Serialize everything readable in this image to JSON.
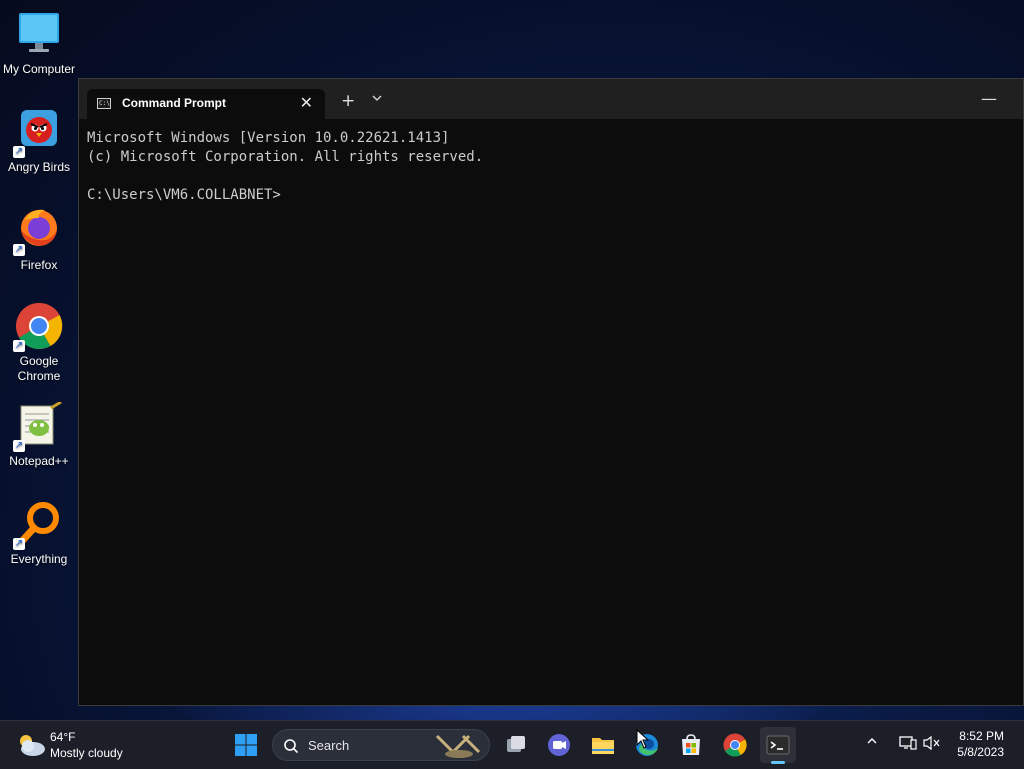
{
  "desktop": {
    "icons": [
      {
        "label": "My Computer",
        "icon": "monitor-icon"
      },
      {
        "label": "Angry Birds",
        "icon": "angry-birds-icon"
      },
      {
        "label": "Firefox",
        "icon": "firefox-icon"
      },
      {
        "label": "Google Chrome",
        "icon": "chrome-icon"
      },
      {
        "label": "Notepad++",
        "icon": "notepadpp-icon"
      },
      {
        "label": "Everything",
        "icon": "everything-search-icon"
      }
    ]
  },
  "terminal": {
    "tab_title": "Command Prompt",
    "tab_close": "✕",
    "new_tab": "+",
    "dropdown": "⌄",
    "minimize": "—",
    "lines": [
      "Microsoft Windows [Version 10.0.22621.1413]",
      "(c) Microsoft Corporation. All rights reserved.",
      "",
      "C:\\Users\\VM6.COLLABNET>"
    ]
  },
  "taskbar": {
    "weather": {
      "temp": "64°F",
      "condition": "Mostly cloudy"
    },
    "search_label": "Search",
    "apps": [
      "start",
      "search",
      "task-view",
      "teams-chat",
      "file-explorer",
      "edge",
      "microsoft-store",
      "chrome",
      "terminal"
    ],
    "tray": {
      "chevron": "^",
      "network": "network-icon",
      "volume": "volume-muted-icon"
    },
    "clock": {
      "time": "8:52 PM",
      "date": "5/8/2023"
    }
  },
  "colors": {
    "terminal_bg": "#0c0c0c",
    "titlebar_bg": "#202020",
    "taskbar_bg": "#1c1f28",
    "accent": "#61c6f5"
  }
}
